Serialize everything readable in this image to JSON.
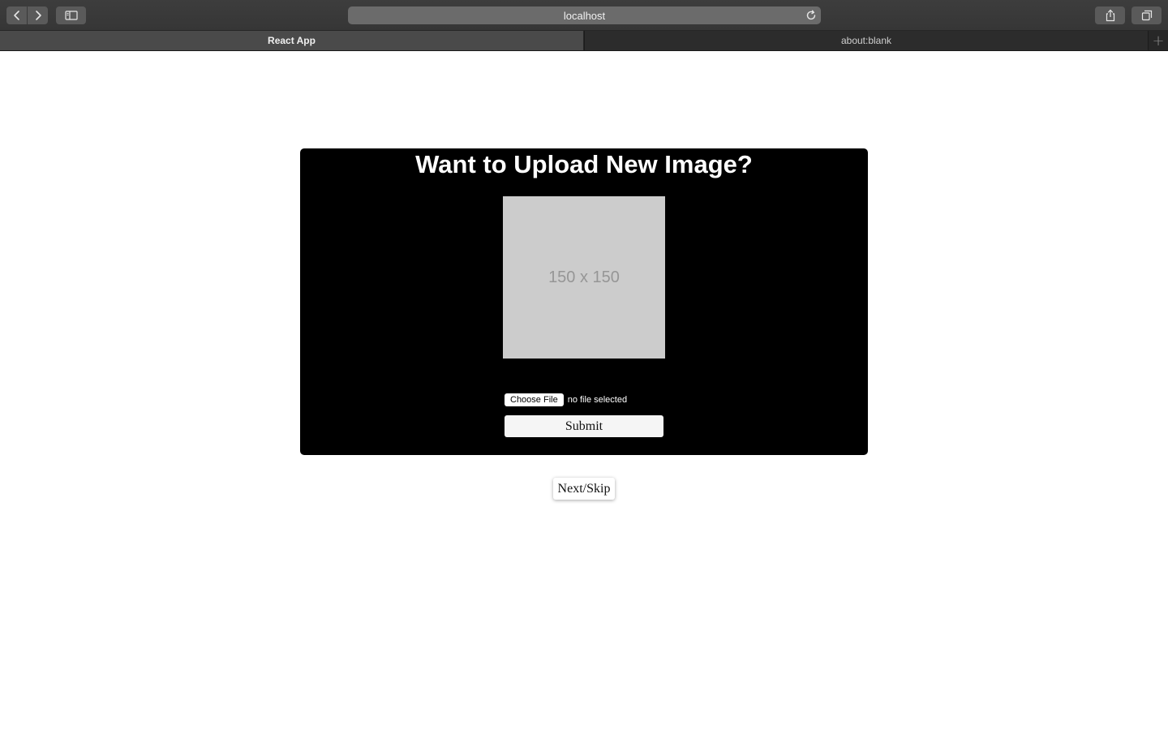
{
  "browser": {
    "address": "localhost",
    "tabs": [
      {
        "label": "React App",
        "active": true
      },
      {
        "label": "about:blank",
        "active": false
      }
    ],
    "icons": {
      "back": "chevron-left-icon",
      "forward": "chevron-right-icon",
      "sidebar": "sidebar-icon",
      "reload": "reload-icon",
      "share": "share-icon",
      "tabs": "tabs-overview-icon",
      "new_tab": "plus-icon"
    },
    "new_tab_glyph": "+"
  },
  "upload": {
    "title": "Want to Upload New Image?",
    "placeholder_text": "150 x 150",
    "choose_file_label": "Choose File",
    "file_status": "no file selected",
    "submit_label": "Submit"
  },
  "actions": {
    "next_label": "Next/Skip"
  },
  "colors": {
    "card_background": "#000000",
    "title_color": "#ffffff",
    "placeholder_background": "#cccccc",
    "placeholder_text": "#969696"
  }
}
